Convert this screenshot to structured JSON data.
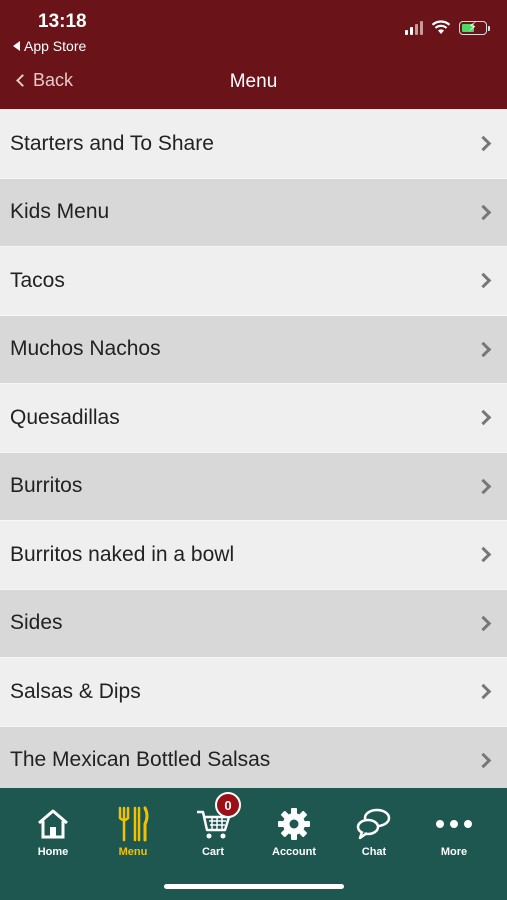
{
  "status": {
    "time": "13:18",
    "back_app": "App Store"
  },
  "nav": {
    "back_label": "Back",
    "title": "Menu"
  },
  "menu_items": [
    {
      "label": "Starters and To Share"
    },
    {
      "label": "Kids Menu"
    },
    {
      "label": "Tacos"
    },
    {
      "label": "Muchos Nachos"
    },
    {
      "label": "Quesadillas"
    },
    {
      "label": "Burritos"
    },
    {
      "label": "Burritos naked in a bowl"
    },
    {
      "label": "Sides"
    },
    {
      "label": "Salsas & Dips"
    },
    {
      "label": "The Mexican Bottled Salsas"
    }
  ],
  "tabs": [
    {
      "label": "Home",
      "icon": "home-icon"
    },
    {
      "label": "Menu",
      "icon": "fork-knife-icon",
      "active": true
    },
    {
      "label": "Cart",
      "icon": "cart-icon",
      "badge": "0"
    },
    {
      "label": "Account",
      "icon": "gear-icon"
    },
    {
      "label": "Chat",
      "icon": "chat-icon"
    },
    {
      "label": "More",
      "icon": "more-icon"
    }
  ],
  "colors": {
    "header": "#6a1419",
    "tabbar": "#1d574f",
    "active_tab": "#f2c200",
    "badge": "#9b0f17"
  }
}
